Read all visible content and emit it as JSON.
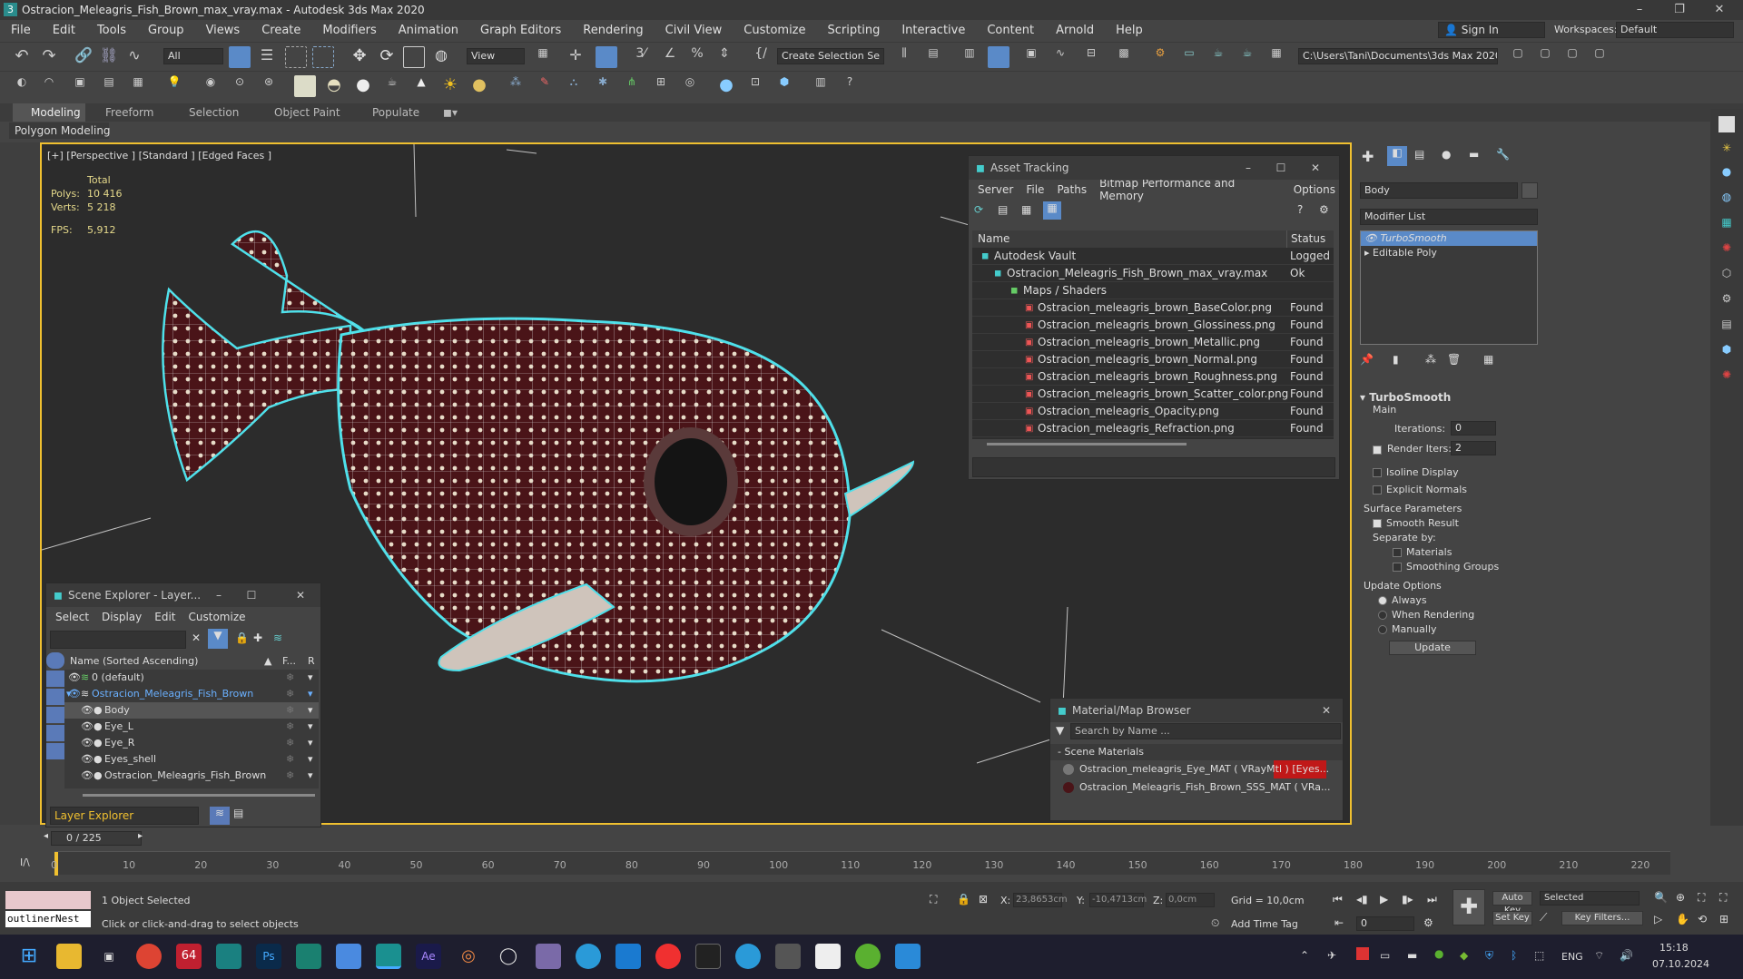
{
  "window": {
    "title": "Ostracion_Meleagris_Fish_Brown_max_vray.max - Autodesk 3ds Max 2020"
  },
  "menu": [
    "File",
    "Edit",
    "Tools",
    "Group",
    "Views",
    "Create",
    "Modifiers",
    "Animation",
    "Graph Editors",
    "Rendering",
    "Civil View",
    "Customize",
    "Scripting",
    "Interactive",
    "Content",
    "Arnold",
    "Help"
  ],
  "account": {
    "signin": "Sign In",
    "workspaces_label": "Workspaces:",
    "workspace": "Default"
  },
  "toolbar": {
    "filter": "All",
    "ref_coord": "View",
    "selection_set": "Create Selection Se",
    "project_path": "C:\\Users\\Tani\\Documents\\3ds Max 2020"
  },
  "ribbon": {
    "tabs": [
      "Modeling",
      "Freeform",
      "Selection",
      "Object Paint",
      "Populate"
    ],
    "sub": "Polygon Modeling"
  },
  "viewport": {
    "label": "[+] [Perspective ] [Standard ] [Edged Faces ]",
    "stats_total": "Total",
    "polys_label": "Polys:",
    "polys": "10 416",
    "verts_label": "Verts:",
    "verts": "5 218",
    "fps_label": "FPS:",
    "fps": "5,912"
  },
  "asset_tracking": {
    "title": "Asset Tracking",
    "menu": [
      "Server",
      "File",
      "Paths",
      "Bitmap Performance and Memory",
      "Options"
    ],
    "col_name": "Name",
    "col_status": "Status",
    "rows": [
      {
        "name": "Autodesk Vault",
        "status": "Logged"
      },
      {
        "name": "Ostracion_Meleagris_Fish_Brown_max_vray.max",
        "status": "Ok"
      },
      {
        "name": "Maps / Shaders",
        "status": ""
      },
      {
        "name": "Ostracion_meleagris_brown_BaseColor.png",
        "status": "Found"
      },
      {
        "name": "Ostracion_meleagris_brown_Glossiness.png",
        "status": "Found"
      },
      {
        "name": "Ostracion_meleagris_brown_Metallic.png",
        "status": "Found"
      },
      {
        "name": "Ostracion_meleagris_brown_Normal.png",
        "status": "Found"
      },
      {
        "name": "Ostracion_meleagris_brown_Roughness.png",
        "status": "Found"
      },
      {
        "name": "Ostracion_meleagris_brown_Scatter_color.png",
        "status": "Found"
      },
      {
        "name": "Ostracion_meleagris_Opacity.png",
        "status": "Found"
      },
      {
        "name": "Ostracion_meleagris_Refraction.png",
        "status": "Found"
      }
    ]
  },
  "scene_explorer": {
    "title": "Scene Explorer - Layer...",
    "menu": [
      "Select",
      "Display",
      "Edit",
      "Customize"
    ],
    "col_name": "Name (Sorted Ascending)",
    "col_f": "F...",
    "col_r": "R",
    "rows": [
      "0 (default)",
      "Ostracion_Meleagris_Fish_Brown",
      "Body",
      "Eye_L",
      "Eye_R",
      "Eyes_shell",
      "Ostracion_Meleagris_Fish_Brown"
    ],
    "footer": "Layer Explorer"
  },
  "material_browser": {
    "title": "Material/Map Browser",
    "search": "Search by Name ...",
    "section": "Scene Materials",
    "items": [
      "Ostracion_meleagris_Eye_MAT ( VRayMtl ) [Eyes...",
      "Ostracion_Meleagris_Fish_Brown_SSS_MAT ( VRa..."
    ]
  },
  "command_panel": {
    "object_name": "Body",
    "modifier_list": "Modifier List",
    "stack": [
      "TurboSmooth",
      "Editable Poly"
    ],
    "turbosmooth": {
      "title": "TurboSmooth",
      "main": "Main",
      "iterations_label": "Iterations:",
      "iterations": "0",
      "render_iters_label": "Render Iters:",
      "render_iters": "2",
      "isoline": "Isoline Display",
      "explicit_normals": "Explicit Normals",
      "surface_params": "Surface Parameters",
      "smooth_result": "Smooth Result",
      "separate_by": "Separate by:",
      "materials": "Materials",
      "smoothing_groups": "Smoothing Groups",
      "update_options": "Update Options",
      "always": "Always",
      "when_rendering": "When Rendering",
      "manually": "Manually",
      "update_btn": "Update"
    }
  },
  "timeline": {
    "frame": "0 / 225",
    "ticks": [
      "0",
      "10",
      "20",
      "30",
      "40",
      "50",
      "60",
      "70",
      "80",
      "90",
      "100",
      "110",
      "120",
      "130",
      "140",
      "150",
      "160",
      "170",
      "180",
      "190",
      "200",
      "210",
      "220"
    ]
  },
  "status": {
    "objects_selected": "1 Object Selected",
    "prompt": "Click or click-and-drag to select objects",
    "maxscript": "outlinerNest",
    "x_label": "X:",
    "x": "23,8653cm",
    "y_label": "Y:",
    "y": "-10,4713cm",
    "z_label": "Z:",
    "z": "0,0cm",
    "grid": "Grid = 10,0cm",
    "add_time_tag": "Add Time Tag",
    "auto_key": "Auto Key",
    "set_key": "Set Key",
    "selected": "Selected",
    "key_filters": "Key Filters...",
    "frame_field": "0"
  },
  "taskbar": {
    "lang": "ENG",
    "time": "15:18",
    "date": "07.10.2024"
  }
}
